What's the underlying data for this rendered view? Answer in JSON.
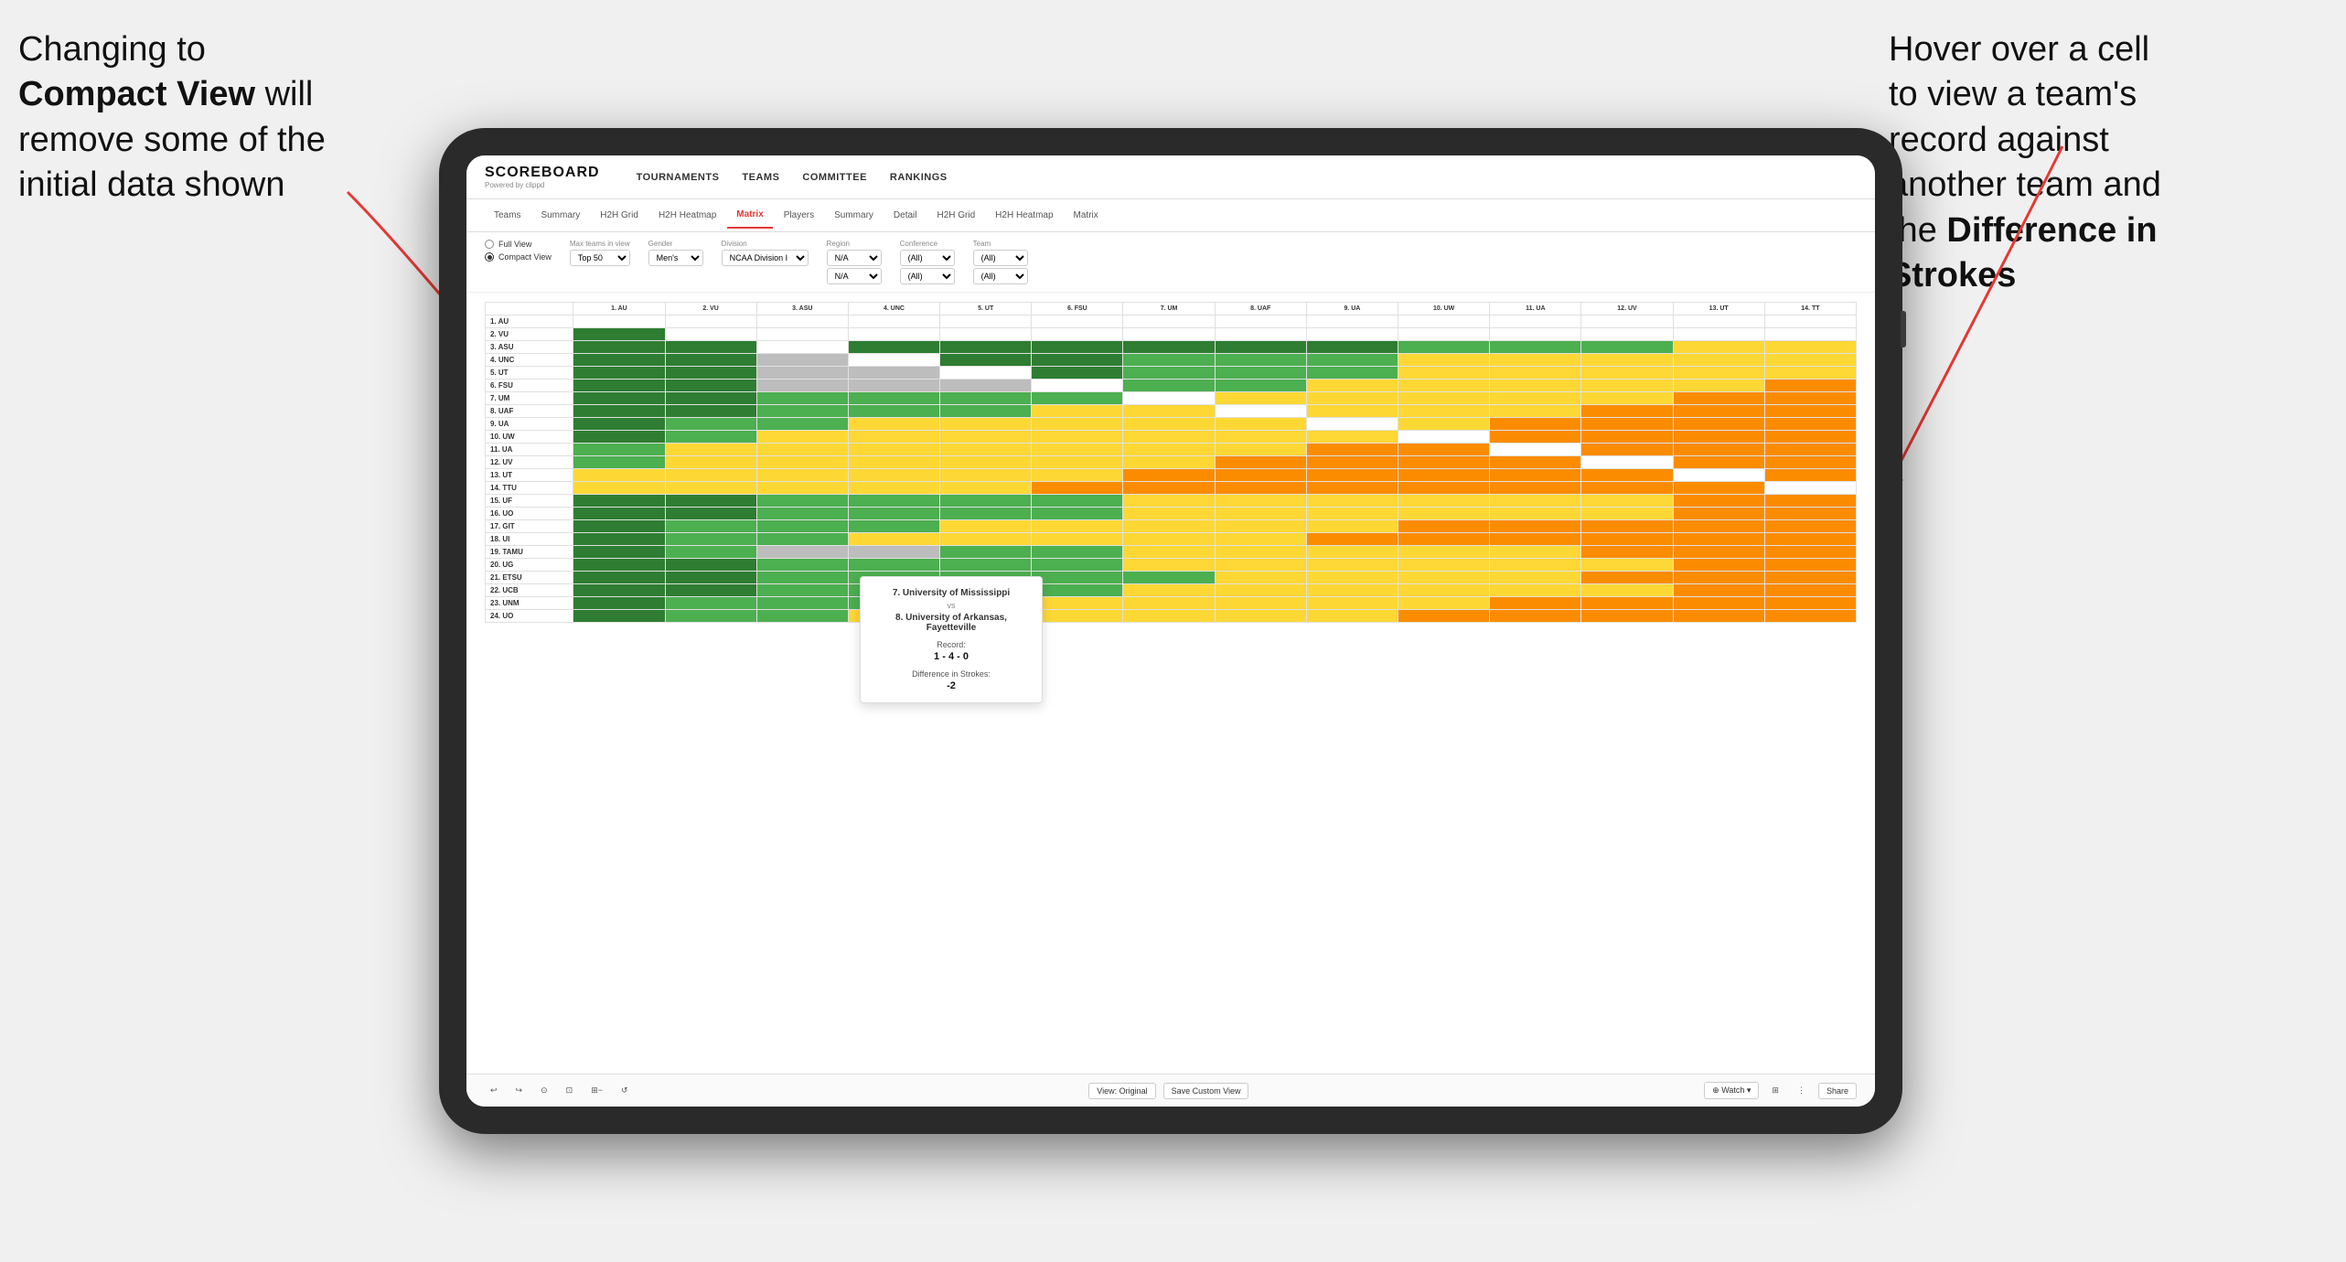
{
  "annotation_left": {
    "line1": "Changing to",
    "line2_bold": "Compact View",
    "line2_rest": " will",
    "line3": "remove some of the",
    "line4": "initial data shown"
  },
  "annotation_right": {
    "line1": "Hover over a cell",
    "line2": "to view a team's",
    "line3": "record against",
    "line4": "another team and",
    "line5_pre": "the ",
    "line5_bold": "Difference in",
    "line6_bold": "Strokes"
  },
  "nav": {
    "logo": "SCOREBOARD",
    "logo_sub": "Powered by clippd",
    "items": [
      "TOURNAMENTS",
      "TEAMS",
      "COMMITTEE",
      "RANKINGS"
    ]
  },
  "sub_tabs": {
    "groups": [
      {
        "label": "Teams"
      },
      {
        "label": "Summary"
      },
      {
        "label": "H2H Grid"
      },
      {
        "label": "H2H Heatmap"
      },
      {
        "label": "Matrix",
        "active": true
      },
      {
        "label": "Players"
      },
      {
        "label": "Summary"
      },
      {
        "label": "Detail"
      },
      {
        "label": "H2H Grid"
      },
      {
        "label": "H2H Heatmap"
      },
      {
        "label": "Matrix"
      }
    ]
  },
  "controls": {
    "view_options": {
      "full_view": "Full View",
      "compact_view": "Compact View",
      "selected": "compact"
    },
    "filters": [
      {
        "label": "Max teams in view",
        "value": "Top 50"
      },
      {
        "label": "Gender",
        "value": "Men's"
      },
      {
        "label": "Division",
        "value": "NCAA Division I"
      },
      {
        "label": "Region",
        "value": "N/A",
        "value2": "N/A"
      },
      {
        "label": "Conference",
        "value": "(All)",
        "value2": "(All)"
      },
      {
        "label": "Team",
        "value": "(All)",
        "value2": "(All)"
      }
    ]
  },
  "col_headers": [
    "1. AU",
    "2. VU",
    "3. ASU",
    "4. UNC",
    "5. UT",
    "6. FSU",
    "7. UM",
    "8. UAF",
    "9. UA",
    "10. UW",
    "11. UA",
    "12. UV",
    "13. UT",
    "14. TT"
  ],
  "row_headers": [
    "1. AU",
    "2. VU",
    "3. ASU",
    "4. UNC",
    "5. UT",
    "6. FSU",
    "7. UM",
    "8. UAF",
    "9. UA",
    "10. UW",
    "11. UA",
    "12. UV",
    "13. UT",
    "14. TTU",
    "15. UF",
    "16. UO",
    "17. GIT",
    "18. UI",
    "19. TAMU",
    "20. UG",
    "21. ETSU",
    "22. UCB",
    "23. UNM",
    "24. UO"
  ],
  "tooltip": {
    "team1": "7. University of Mississippi",
    "vs": "vs",
    "team2": "8. University of Arkansas, Fayetteville",
    "record_label": "Record:",
    "record_value": "1 - 4 - 0",
    "strokes_label": "Difference in Strokes:",
    "strokes_value": "-2"
  },
  "bottom_toolbar": {
    "left_buttons": [
      "↩",
      "↪",
      "⊙",
      "⊡",
      "⊞−",
      "↺"
    ],
    "center_buttons": [
      "View: Original",
      "Save Custom View"
    ],
    "right_buttons": [
      "⊕ Watch ▾",
      "⊞",
      "⋮",
      "Share"
    ]
  }
}
